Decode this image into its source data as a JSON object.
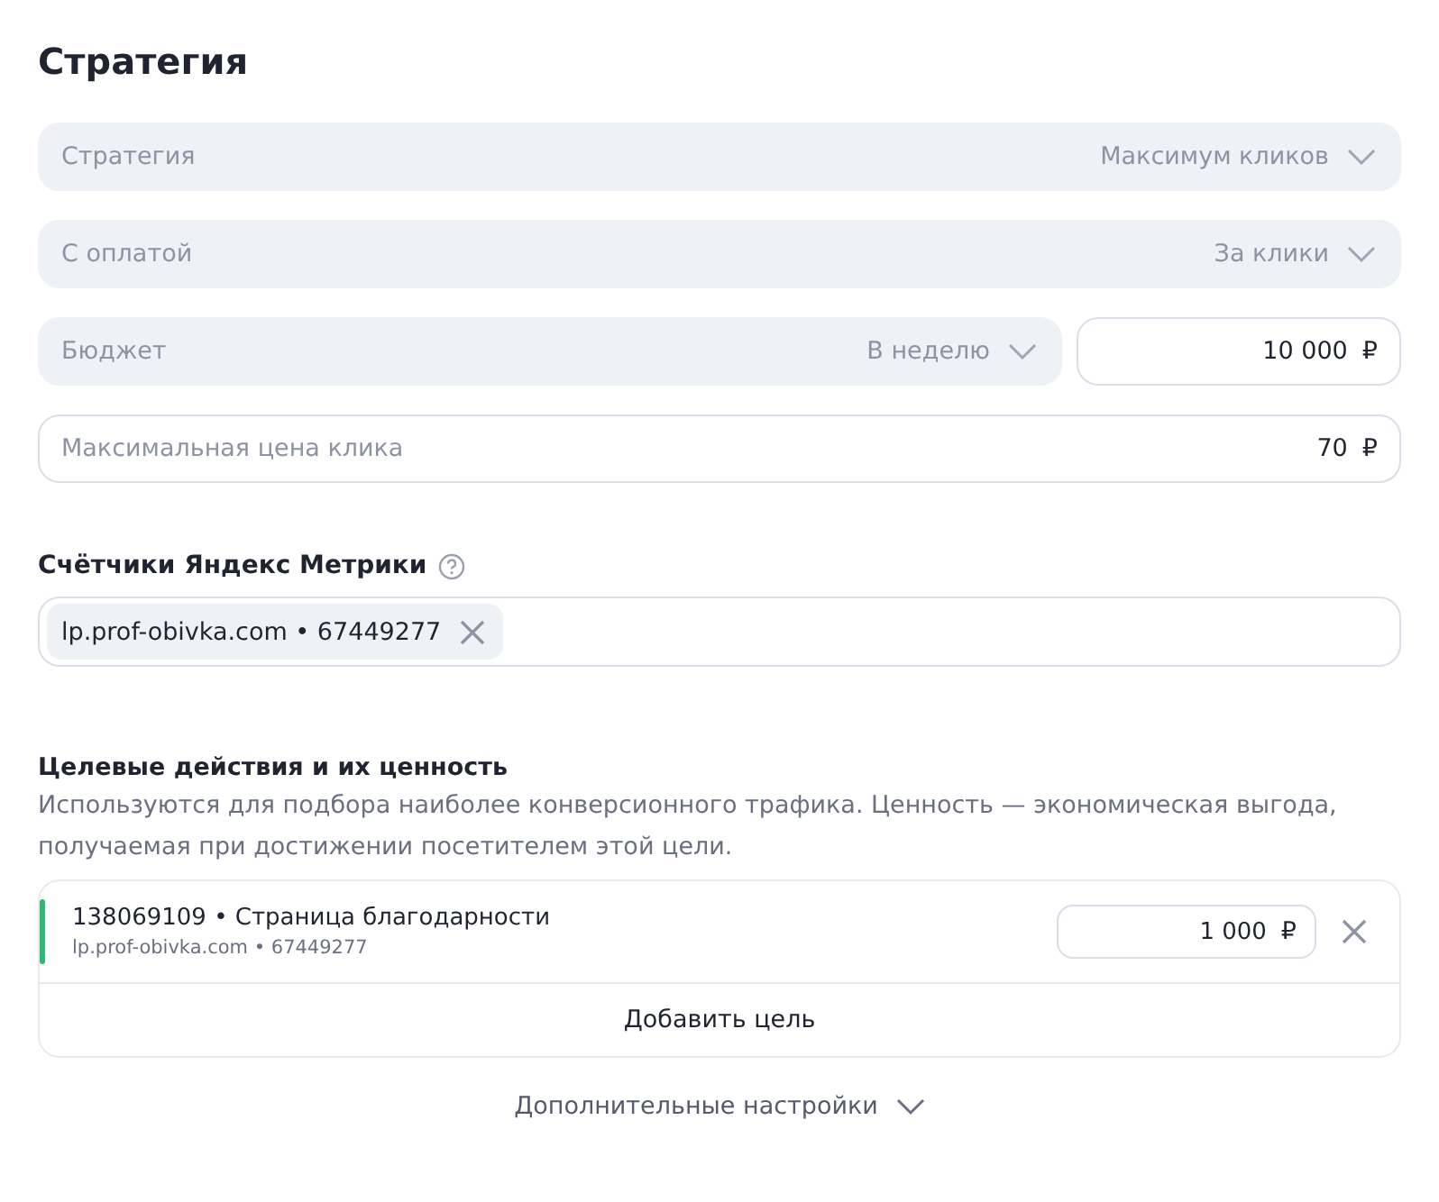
{
  "title": "Стратегия",
  "selects": [
    {
      "label": "Стратегия",
      "value": "Максимум кликов"
    },
    {
      "label": "С оплатой",
      "value": "За клики"
    }
  ],
  "budget": {
    "label": "Бюджет",
    "value": "В неделю",
    "amount": "10 000",
    "currency": "₽"
  },
  "max_price": {
    "placeholder": "Максимальная цена клика",
    "amount": "70",
    "currency": "₽"
  },
  "counters": {
    "label": "Счётчики Яндекс Метрики",
    "chips": [
      {
        "text": "lp.prof-obivka.com • 67449277"
      }
    ]
  },
  "goals": {
    "heading": "Целевые действия и их ценность",
    "description": "Используются для подбора наиболее конверсионного трафика. Ценность — экономическая выгода, получаемая при достижении посетителем этой цели.",
    "items": [
      {
        "title": "138069109 • Страница благодарности",
        "subtitle": "lp.prof-obivka.com • 67449277",
        "amount": "1 000",
        "currency": "₽",
        "color": "#2eb872"
      }
    ],
    "add_button": "Добавить цель"
  },
  "more_settings": "Дополнительные настройки"
}
